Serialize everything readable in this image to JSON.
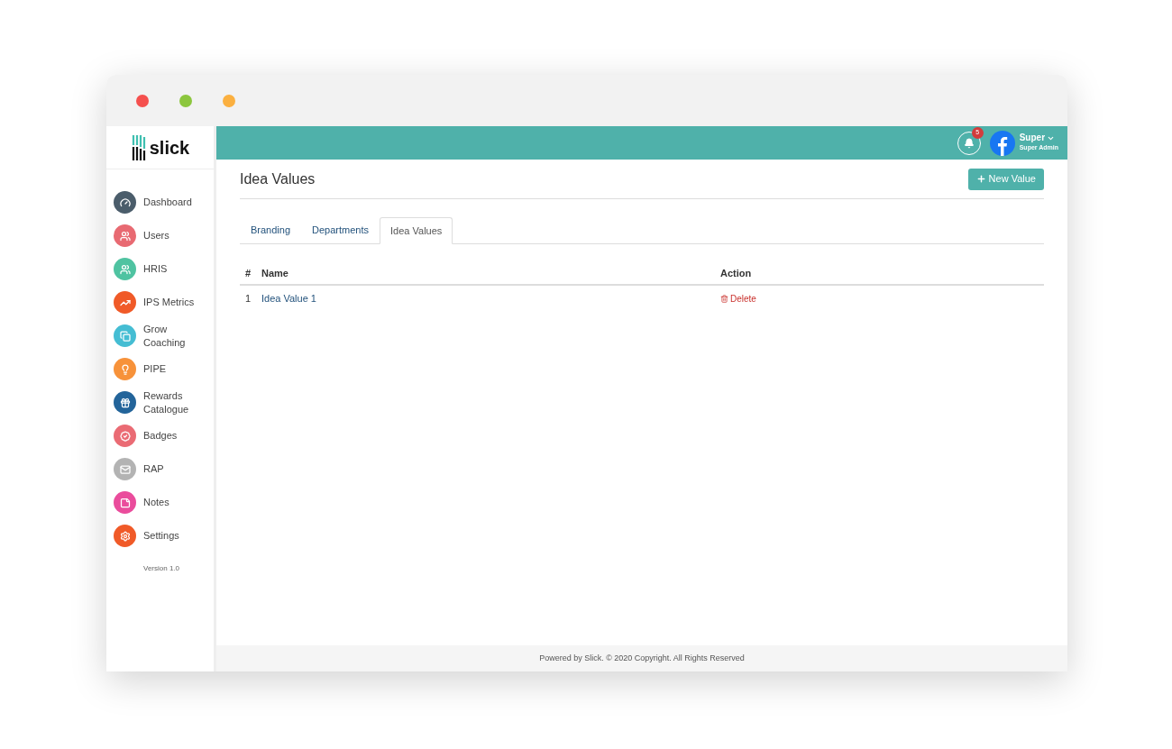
{
  "brand": {
    "name": "slick"
  },
  "sidebar": {
    "items": [
      {
        "label": "Dashboard",
        "color": "#4b5d6b"
      },
      {
        "label": "Users",
        "color": "#e86a72"
      },
      {
        "label": "HRIS",
        "color": "#4fc3a1"
      },
      {
        "label": "IPS Metrics",
        "color": "#f05a28"
      },
      {
        "label": "Grow Coaching",
        "color": "#45bdd3"
      },
      {
        "label": "PIPE",
        "color": "#f7923a"
      },
      {
        "label": "Rewards Catalogue",
        "color": "#23649a"
      },
      {
        "label": "Badges",
        "color": "#ea6b74"
      },
      {
        "label": "RAP",
        "color": "#b3b3b3"
      },
      {
        "label": "Notes",
        "color": "#ea4c9c"
      },
      {
        "label": "Settings",
        "color": "#f05a28"
      }
    ],
    "version": "Version 1.0"
  },
  "header": {
    "notification_count": "5",
    "user_name": "Super",
    "user_role": "Super Admin"
  },
  "page": {
    "title": "Idea Values",
    "new_button": "New Value"
  },
  "tabs": [
    {
      "label": "Branding",
      "selected": false
    },
    {
      "label": "Departments",
      "selected": false
    },
    {
      "label": "Idea Values",
      "selected": true
    }
  ],
  "table": {
    "columns": [
      "#",
      "Name",
      "Action"
    ],
    "rows": [
      {
        "index": "1",
        "name": "Idea Value 1",
        "action": "Delete"
      }
    ]
  },
  "footer": "Powered by Slick. © 2020 Copyright. All Rights Reserved"
}
